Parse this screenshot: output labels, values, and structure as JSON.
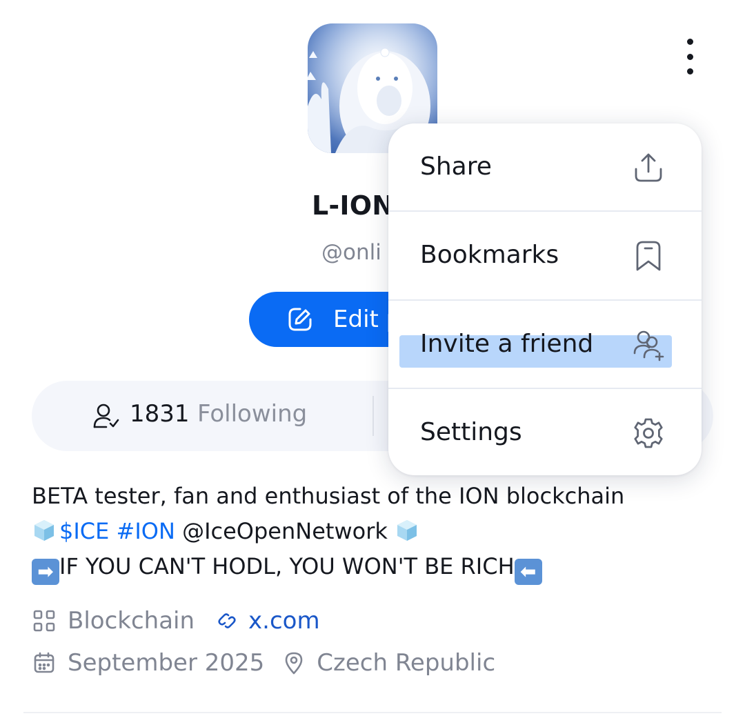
{
  "profile": {
    "name": "L-ION",
    "handle": "@onli",
    "edit_label": "Edit p",
    "stats": {
      "following_count": "1831",
      "following_label": "Following"
    }
  },
  "bio": {
    "line1": "BETA tester, fan and enthusiast of the ION blockchain",
    "line2_ticker": "$ICE",
    "line2_tag": "#ION",
    "line2_mention": "@IceOpenNetwork",
    "line3": "IF YOU CAN'T HODL, YOU WON'T BE RICH",
    "arrow_right": "➡",
    "arrow_left": "⬅"
  },
  "meta": {
    "category": "Blockchain",
    "website": "x.com",
    "joined": "September 2025",
    "location": "Czech Republic"
  },
  "menu": {
    "items": [
      {
        "label": "Share",
        "icon": "share-icon"
      },
      {
        "label": "Bookmarks",
        "icon": "bookmark-icon"
      },
      {
        "label": "Invite a friend",
        "icon": "invite-friend-icon"
      },
      {
        "label": "Settings",
        "icon": "settings-icon"
      }
    ]
  },
  "colors": {
    "accent": "#0a6bf4",
    "text": "#15181f",
    "muted": "#808592",
    "highlight": "#b8d6fb"
  }
}
